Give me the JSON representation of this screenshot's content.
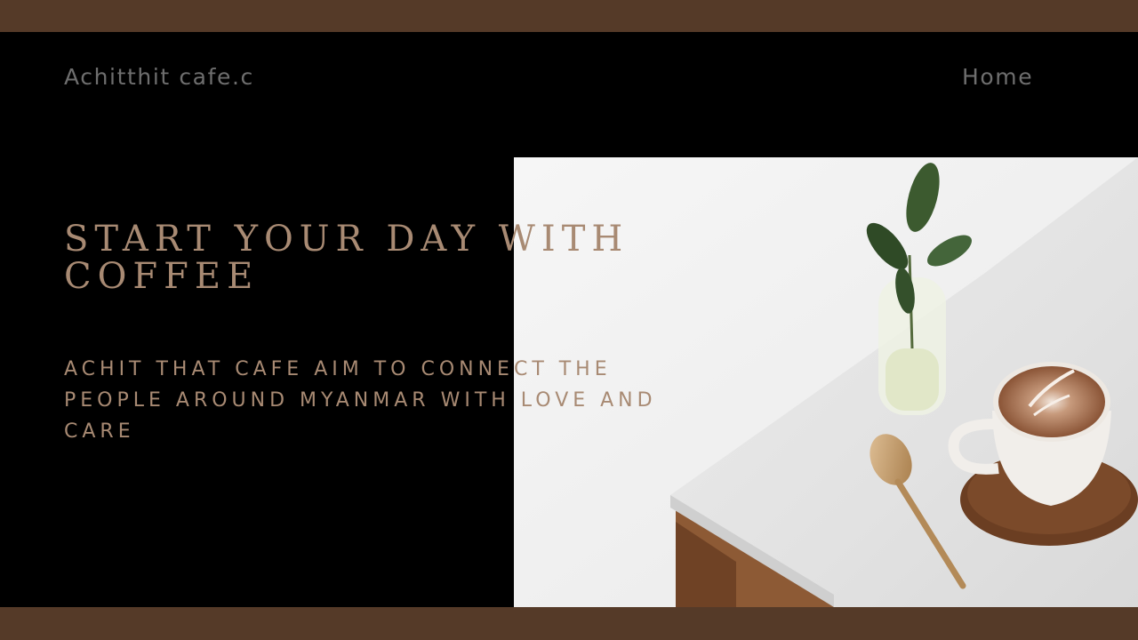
{
  "header": {
    "brand": "Achitthit cafe.c",
    "nav_home": "Home"
  },
  "hero": {
    "headline": "START YOUR DAY WITH COFFEE",
    "tagline": "ACHIT THAT CAFE AIM TO CONNECT THE PEOPLE AROUND MYANMAR WITH LOVE AND CARE"
  },
  "colors": {
    "band": "#553a28",
    "background": "#000000",
    "accent_text": "#a88a73",
    "nav_text": "#6e6e6e"
  }
}
